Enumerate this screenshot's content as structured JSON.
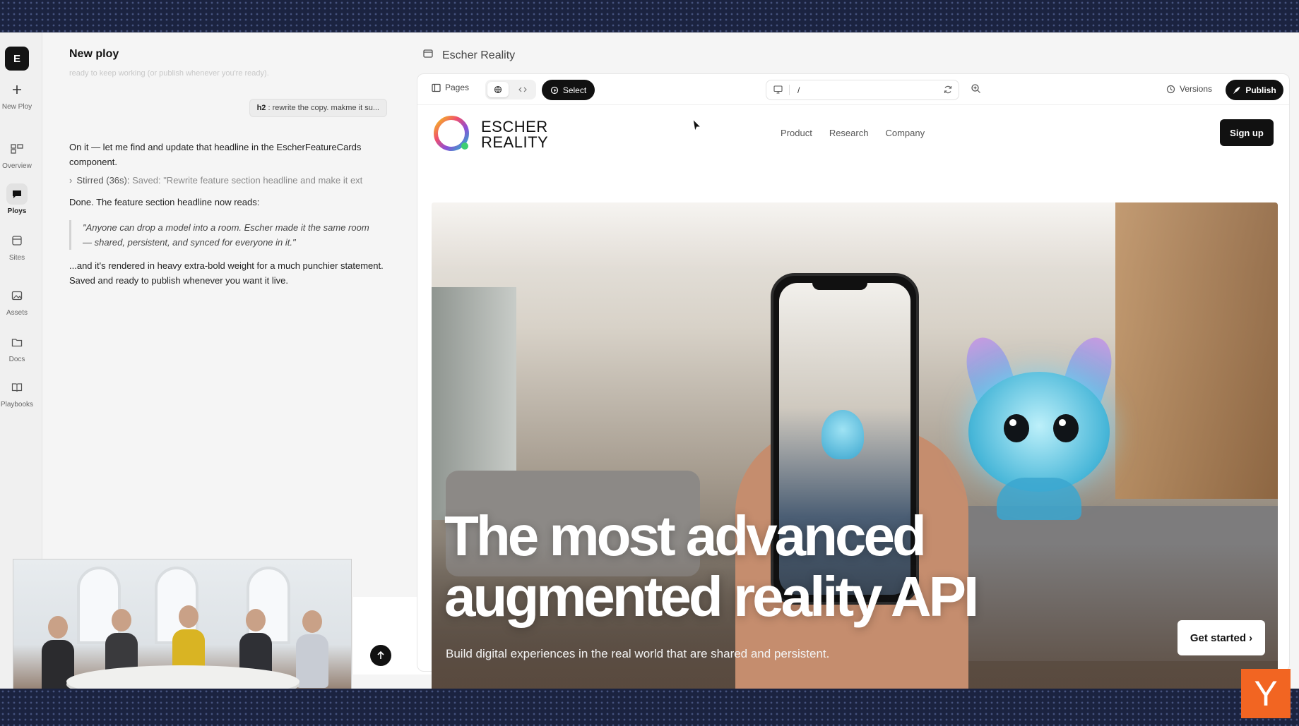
{
  "sidebar": {
    "logo_letter": "E",
    "items": [
      {
        "label": "New Ploy",
        "icon": "plus-icon"
      },
      {
        "label": "Overview",
        "icon": "overview-icon"
      },
      {
        "label": "Ploys",
        "icon": "chat-bubble-icon"
      },
      {
        "label": "Sites",
        "icon": "browser-window-icon"
      },
      {
        "label": "Assets",
        "icon": "image-icon"
      },
      {
        "label": "Docs",
        "icon": "folder-icon"
      },
      {
        "label": "Playbooks",
        "icon": "book-icon"
      }
    ],
    "active": "Ploys"
  },
  "chat": {
    "title": "New ploy",
    "faded_prev": "ready to keep working (or publish whenever you're ready).",
    "user_message": {
      "tag": "h2",
      "text": " : rewrite the copy. makme it su..."
    },
    "assistant_intro": "On it — let me find and update that headline in the EscherFeatureCards component.",
    "tool_call": {
      "label": "Stirred (36s):",
      "detail": "Saved: \"Rewrite feature section headline and make it ext"
    },
    "done_text": "Done. The feature section headline now reads:",
    "quote": "\"Anyone can drop a model into a room. Escher made it the same room — shared, persistent, and synced for everyone in it.\"",
    "closing": "...and it's rendered in heavy extra-bold weight for a much punchier statement. Saved and ready to publish whenever you want it live."
  },
  "builder": {
    "project_name": "Escher Reality",
    "toolbar": {
      "pages_label": "Pages",
      "select_label": "Select",
      "url_path": "/",
      "versions_label": "Versions",
      "publish_label": "Publish"
    }
  },
  "preview": {
    "brand_line1": "ESCHER",
    "brand_line2": "REALITY",
    "nav_links": [
      "Product",
      "Research",
      "Company"
    ],
    "signup_label": "Sign up",
    "hero_title": "The most advanced augmented reality API",
    "hero_subtitle": "Build digital experiences in the real world that are shared and persistent.",
    "cta_label": "Get started ›"
  },
  "badge": {
    "letter": "Y",
    "color": "#f26522"
  },
  "colors": {
    "accent_dark": "#111111",
    "background": "#1b2340"
  }
}
